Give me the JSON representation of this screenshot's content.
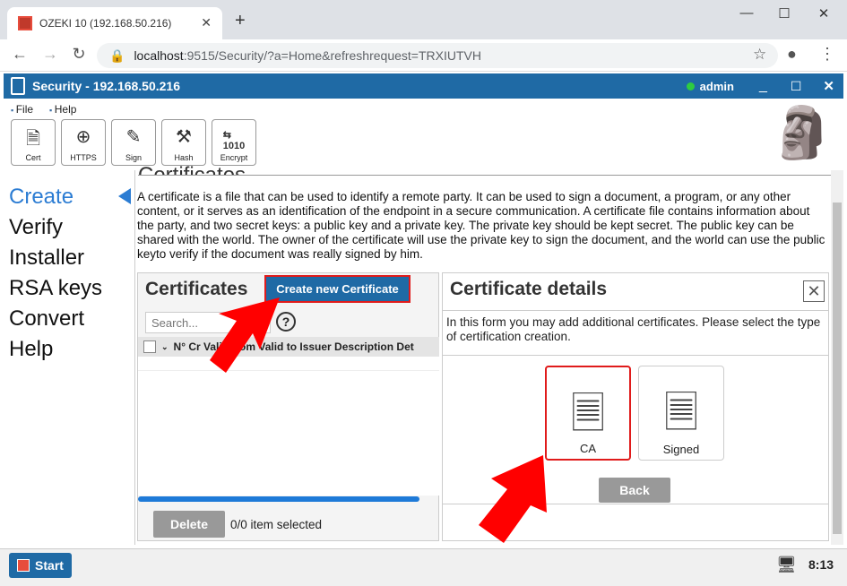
{
  "browser": {
    "tab_title": "OZEKI 10 (192.168.50.216)",
    "new_tab": "+",
    "minimize": "—",
    "maximize": "☐",
    "close": "✕",
    "url_host": "localhost",
    "url_rest": ":9515/Security/?a=Home&refreshrequest=TRXIUTVH"
  },
  "app": {
    "title": "Security - 192.168.50.216",
    "user": "admin",
    "menu": [
      "File",
      "Help"
    ],
    "toolbar": [
      {
        "label": "Cert",
        "icon": "cert-icon"
      },
      {
        "label": "HTTPS",
        "icon": "globe-icon"
      },
      {
        "label": "Sign",
        "icon": "sign-icon"
      },
      {
        "label": "Hash",
        "icon": "hammer-icon"
      },
      {
        "label": "Encrypt",
        "icon": "binary-icon"
      }
    ]
  },
  "nav": {
    "items": [
      "Create",
      "Verify",
      "Installer",
      "RSA keys",
      "Convert",
      "Help"
    ],
    "active": "Create"
  },
  "main": {
    "heading": "Certificates",
    "description": "A certificate is a file that can be used to identify a remote party. It can be used to sign a document, a program, or any other content, or it serves as an identification of the endpoint in a secure communication. A certificate file contains information about the party, and two secret keys: a public key and a private key. The private key should be kept secret. The public key can be shared with the world. The owner of the certificate will use the private key to sign the document, and the world can use the public keyto verify if the document was really signed by him."
  },
  "left_panel": {
    "title": "Certificates",
    "create_button": "Create new Certificate",
    "search_placeholder": "Search...",
    "help": "?",
    "columns": "N° Cr        Valid from  Valid to  Issuer  Description  Det",
    "delete_button": "Delete",
    "selection_status": "0/0 item selected"
  },
  "right_panel": {
    "title": "Certificate details",
    "description": "In this form you may add additional certificates. Please select the type of certification creation.",
    "options": [
      "CA",
      "Signed"
    ],
    "back_button": "Back"
  },
  "taskbar": {
    "start": "Start",
    "time": "8:13"
  },
  "colors": {
    "accent": "#1f6aa5",
    "highlight": "#e01b1b",
    "nav_active": "#2b7cd3"
  }
}
